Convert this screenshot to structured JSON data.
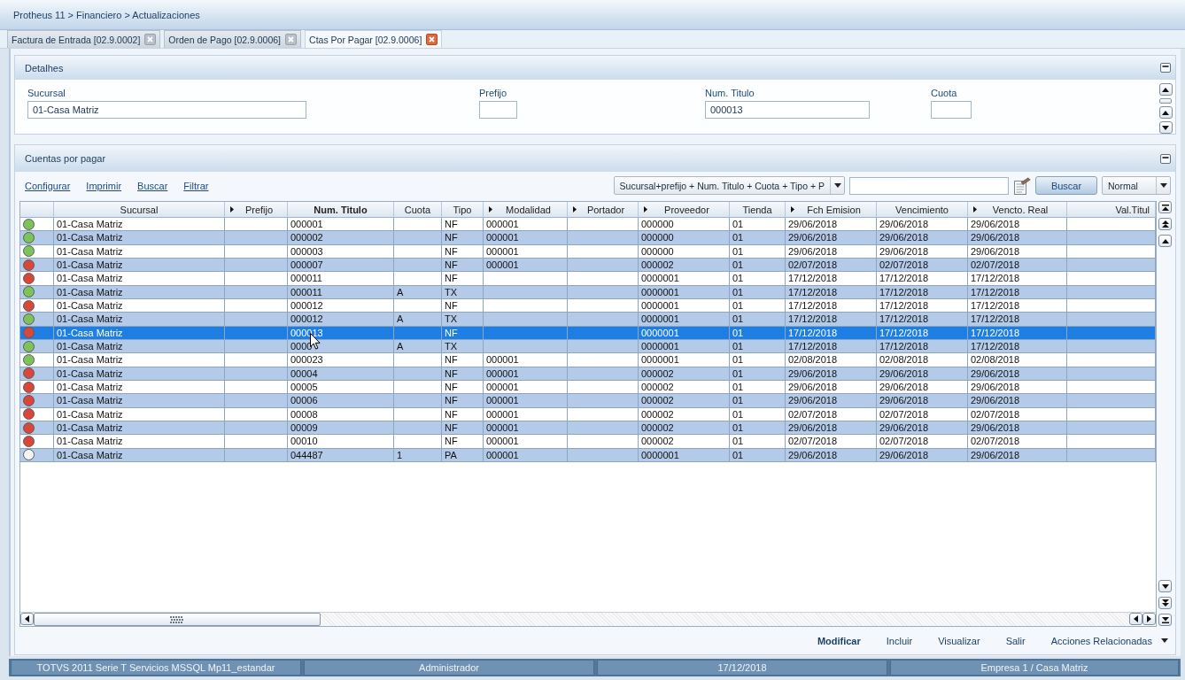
{
  "breadcrumb": "Protheus 11 > Financiero > Actualizaciones",
  "tabs": [
    {
      "label": "Factura de Entrada [02.9.0002]",
      "selected": false
    },
    {
      "label": "Orden de Pago [02.9.0006]",
      "selected": false
    },
    {
      "label": "Ctas Por Pagar [02.9.0006]",
      "selected": true
    }
  ],
  "details": {
    "title": "Detalhes",
    "fields": [
      {
        "label": "Sucursal",
        "value": "01-Casa Matriz"
      },
      {
        "label": "Prefijo"
      },
      {
        "label": "Num. Titulo",
        "value": "000013"
      },
      {
        "label": "Cuota"
      }
    ]
  },
  "list": {
    "title": "Cuentas por pagar",
    "links": [
      "Configurar",
      "Imprimir",
      "Buscar",
      "Filtrar"
    ],
    "order_select": "Sucursal+prefijo + Num. Titulo + Cuota + Tipo + P",
    "search_button": "Buscar",
    "mode_select": "Normal",
    "table": {
      "columns": [
        {
          "label": "Sucursal",
          "arrow": false,
          "sorted": false
        },
        {
          "label": "Prefijo",
          "arrow": true,
          "sorted": false
        },
        {
          "label": "Num. Titulo",
          "arrow": false,
          "sorted": true
        },
        {
          "label": "Cuota",
          "arrow": false,
          "sorted": false
        },
        {
          "label": "Tipo",
          "arrow": false,
          "sorted": false
        },
        {
          "label": "Modalidad",
          "arrow": true,
          "sorted": false
        },
        {
          "label": "Portador",
          "arrow": true,
          "sorted": false
        },
        {
          "label": "Proveedor",
          "arrow": true,
          "sorted": false
        },
        {
          "label": "Tienda",
          "arrow": false,
          "sorted": false
        },
        {
          "label": "Fch Emision",
          "arrow": true,
          "sorted": false
        },
        {
          "label": "Vencimiento",
          "arrow": false,
          "sorted": false
        },
        {
          "label": "Vencto. Real",
          "arrow": true,
          "sorted": false
        },
        {
          "label": "Val.Titul",
          "arrow": false,
          "sorted": false
        }
      ],
      "rows": [
        {
          "color": "#7cc45a",
          "selected": false,
          "cells": [
            "01-Casa Matriz",
            null,
            "000001",
            null,
            "NF",
            "000001",
            null,
            "000000",
            "01",
            "29/06/2018",
            "29/06/2018",
            "29/06/2018",
            null
          ]
        },
        {
          "color": "#7cc45a",
          "selected": false,
          "cells": [
            "01-Casa Matriz",
            null,
            "000002",
            null,
            "NF",
            "000001",
            null,
            "000000",
            "01",
            "29/06/2018",
            "29/06/2018",
            "29/06/2018",
            null
          ]
        },
        {
          "color": "#7cc45a",
          "selected": false,
          "cells": [
            "01-Casa Matriz",
            null,
            "000003",
            null,
            "NF",
            "000001",
            null,
            "000000",
            "01",
            "29/06/2018",
            "29/06/2018",
            "29/06/2018",
            null
          ]
        },
        {
          "color": "#d9473b",
          "selected": false,
          "cells": [
            "01-Casa Matriz",
            null,
            "000007",
            null,
            "NF",
            "000001",
            null,
            "000002",
            "01",
            "02/07/2018",
            "02/07/2018",
            "02/07/2018",
            null
          ]
        },
        {
          "color": "#d9473b",
          "selected": false,
          "cells": [
            "01-Casa Matriz",
            null,
            "000011",
            null,
            "NF",
            null,
            null,
            "0000001",
            "01",
            "17/12/2018",
            "17/12/2018",
            "17/12/2018",
            null
          ]
        },
        {
          "color": "#7cc45a",
          "selected": false,
          "cells": [
            "01-Casa Matriz",
            null,
            "000011",
            "A",
            "TX",
            null,
            null,
            "0000001",
            "01",
            "17/12/2018",
            "17/12/2018",
            "17/12/2018",
            null
          ]
        },
        {
          "color": "#d9473b",
          "selected": false,
          "cells": [
            "01-Casa Matriz",
            null,
            "000012",
            null,
            "NF",
            null,
            null,
            "0000001",
            "01",
            "17/12/2018",
            "17/12/2018",
            "17/12/2018",
            null
          ]
        },
        {
          "color": "#7cc45a",
          "selected": false,
          "cells": [
            "01-Casa Matriz",
            null,
            "000012",
            "A",
            "TX",
            null,
            null,
            "0000001",
            "01",
            "17/12/2018",
            "17/12/2018",
            "17/12/2018",
            null
          ]
        },
        {
          "color": "#d9473b",
          "selected": true,
          "cells": [
            "01-Casa Matriz",
            null,
            "000013",
            null,
            "NF",
            null,
            null,
            "0000001",
            "01",
            "17/12/2018",
            "17/12/2018",
            "17/12/2018",
            null
          ]
        },
        {
          "color": "#7cc45a",
          "selected": false,
          "cells": [
            "01-Casa Matriz",
            null,
            "0000",
            "A",
            "TX",
            null,
            null,
            "0000001",
            "01",
            "17/12/2018",
            "17/12/2018",
            "17/12/2018",
            null
          ]
        },
        {
          "color": "#7cc45a",
          "selected": false,
          "cells": [
            "01-Casa Matriz",
            null,
            "000023",
            null,
            "NF",
            "000001",
            null,
            "0000001",
            "01",
            "02/08/2018",
            "02/08/2018",
            "02/08/2018",
            null
          ]
        },
        {
          "color": "#d9473b",
          "selected": false,
          "cells": [
            "01-Casa Matriz",
            null,
            "00004",
            null,
            "NF",
            "000001",
            null,
            "000002",
            "01",
            "29/06/2018",
            "29/06/2018",
            "29/06/2018",
            null
          ]
        },
        {
          "color": "#d9473b",
          "selected": false,
          "cells": [
            "01-Casa Matriz",
            null,
            "00005",
            null,
            "NF",
            "000001",
            null,
            "000002",
            "01",
            "29/06/2018",
            "29/06/2018",
            "29/06/2018",
            null
          ]
        },
        {
          "color": "#d9473b",
          "selected": false,
          "cells": [
            "01-Casa Matriz",
            null,
            "00006",
            null,
            "NF",
            "000001",
            null,
            "000002",
            "01",
            "29/06/2018",
            "29/06/2018",
            "29/06/2018",
            null
          ]
        },
        {
          "color": "#d9473b",
          "selected": false,
          "cells": [
            "01-Casa Matriz",
            null,
            "00008",
            null,
            "NF",
            "000001",
            null,
            "000002",
            "01",
            "02/07/2018",
            "02/07/2018",
            "02/07/2018",
            null
          ]
        },
        {
          "color": "#d9473b",
          "selected": false,
          "cells": [
            "01-Casa Matriz",
            null,
            "00009",
            null,
            "NF",
            "000001",
            null,
            "000002",
            "01",
            "29/06/2018",
            "29/06/2018",
            "29/06/2018",
            null
          ]
        },
        {
          "color": "#d9473b",
          "selected": false,
          "cells": [
            "01-Casa Matriz",
            null,
            "00010",
            null,
            "NF",
            "000001",
            null,
            "000002",
            "01",
            "02/07/2018",
            "02/07/2018",
            "02/07/2018",
            null
          ]
        },
        {
          "color": "#f4f4f4",
          "selected": false,
          "cells": [
            "01-Casa Matriz",
            null,
            "044487",
            "1",
            "PA",
            "000001",
            null,
            "0000001",
            "01",
            "29/06/2018",
            "29/06/2018",
            "29/06/2018",
            null
          ]
        }
      ]
    }
  },
  "actions": [
    {
      "label": "Modificar",
      "primary": true,
      "menu": false
    },
    {
      "label": "Incluir",
      "primary": false,
      "menu": false
    },
    {
      "label": "Visualizar",
      "primary": false,
      "menu": false
    },
    {
      "label": "Salir",
      "primary": false,
      "menu": false
    },
    {
      "label": "Acciones Relacionadas",
      "primary": false,
      "menu": true
    }
  ],
  "status_bar": [
    "TOTVS 2011 Serie T Servicios MSSQL Mp11_estandar",
    "Administrador",
    "17/12/2018",
    "Empresa 1 / Casa Matriz"
  ]
}
